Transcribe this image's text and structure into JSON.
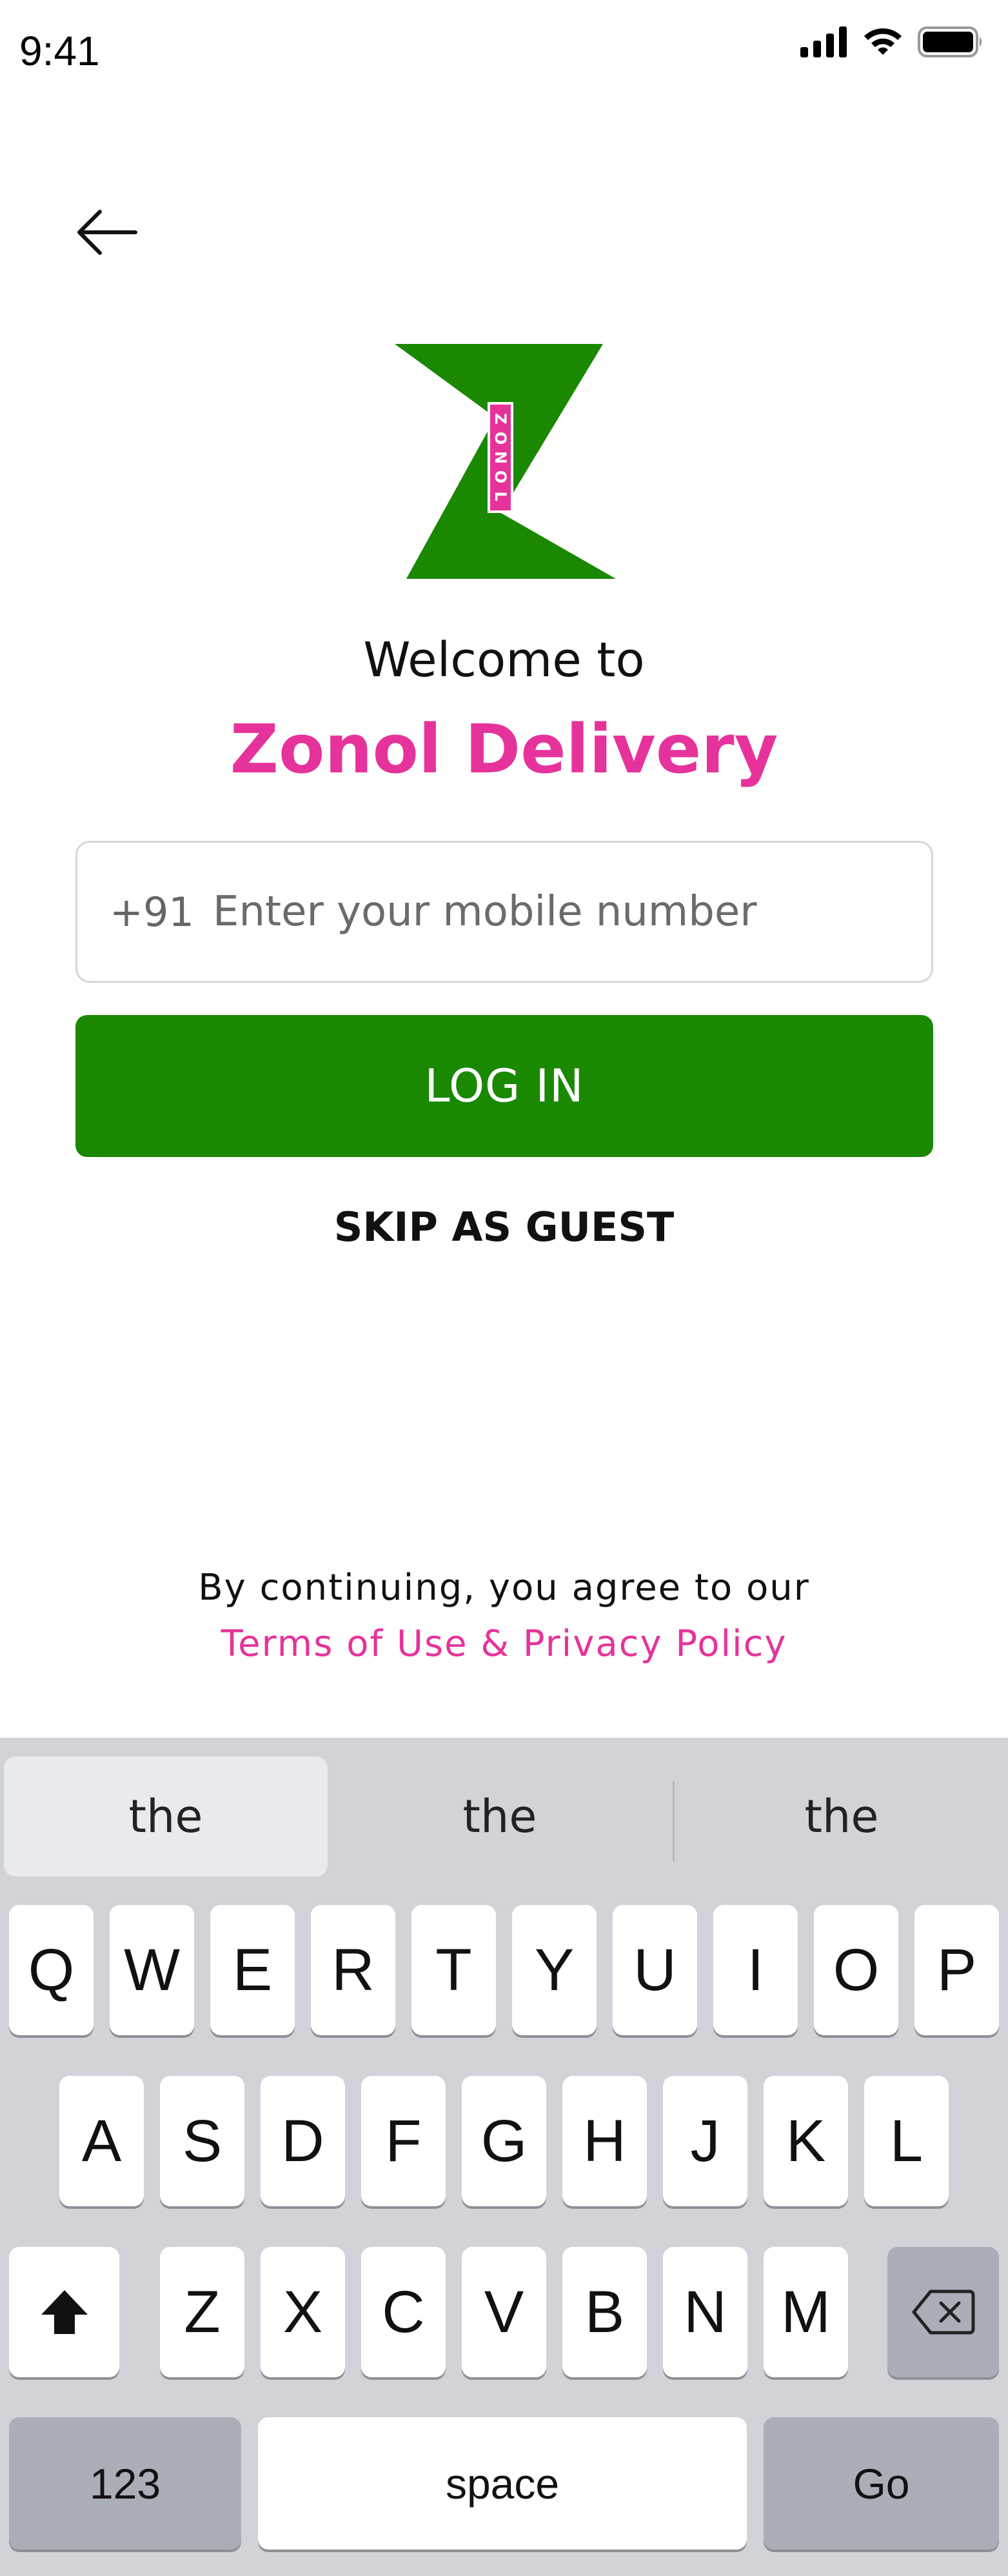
{
  "status_bar": {
    "time": "9:41",
    "icons": [
      "cellular-signal-icon",
      "wifi-icon",
      "battery-icon"
    ]
  },
  "header": {
    "back_icon": "arrow-left-icon"
  },
  "logo": {
    "letters": [
      "Z",
      "O",
      "N",
      "O",
      "L"
    ],
    "colors": {
      "green": "#1a8800",
      "pink": "#e6339b"
    }
  },
  "welcome": {
    "line1": "Welcome to",
    "brand": "Zonol Delivery"
  },
  "form": {
    "country_code": "+91",
    "phone_placeholder": "Enter your mobile number",
    "phone_value": "",
    "login_label": "LOG IN",
    "skip_label": "SKIP AS GUEST"
  },
  "terms": {
    "text": "By continuing, you agree to our",
    "link": "Terms of Use & Privacy Policy"
  },
  "keyboard": {
    "suggestions": [
      "the",
      "the",
      "the"
    ],
    "row1": [
      "Q",
      "W",
      "E",
      "R",
      "T",
      "Y",
      "U",
      "I",
      "O",
      "P"
    ],
    "row2": [
      "A",
      "S",
      "D",
      "F",
      "G",
      "H",
      "J",
      "K",
      "L"
    ],
    "row3": [
      "Z",
      "X",
      "C",
      "V",
      "B",
      "N",
      "M"
    ],
    "shift_icon": "shift-icon",
    "delete_icon": "backspace-icon",
    "numbers_label": "123",
    "space_label": "space",
    "go_label": "Go"
  },
  "colors": {
    "accent_green": "#1a8800",
    "accent_pink": "#e6339b",
    "keyboard_bg": "#d1d3d9"
  }
}
